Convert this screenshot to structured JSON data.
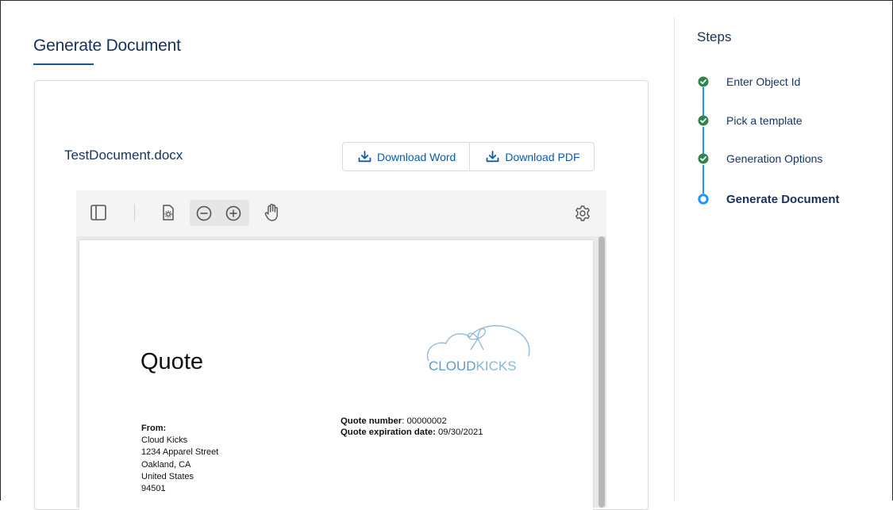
{
  "main": {
    "title": "Generate Document",
    "file_name": "TestDocument.docx",
    "download_word_label": "Download Word",
    "download_pdf_label": "Download PDF"
  },
  "viewer": {
    "toolbar_icons": [
      "sidebar-toggle-icon",
      "document-properties-icon",
      "zoom-out-icon",
      "zoom-in-icon",
      "pan-hand-icon",
      "settings-gear-icon"
    ]
  },
  "document": {
    "title": "Quote",
    "logo_text_bold": "CLOUD",
    "logo_text_light": "KICKS",
    "from_label": "From:",
    "from_lines": [
      "Cloud Kicks",
      "1234 Apparel Street",
      "Oakland, CA",
      "United States",
      "94501"
    ],
    "quote_number_label": "Quote number",
    "quote_number_value": ": 00000002",
    "quote_expiration_label": "Quote expiration date:",
    "quote_expiration_value": " 09/30/2021"
  },
  "steps": {
    "title": "Steps",
    "items": [
      {
        "label": "Enter Object Id",
        "status": "complete"
      },
      {
        "label": "Pick a template",
        "status": "complete"
      },
      {
        "label": "Generation Options",
        "status": "complete"
      },
      {
        "label": "Generate Document",
        "status": "active"
      }
    ]
  },
  "colors": {
    "heading": "#16325c",
    "link": "#0b5cab",
    "step_complete": "#2e844a",
    "step_active": "#1b96ff"
  }
}
